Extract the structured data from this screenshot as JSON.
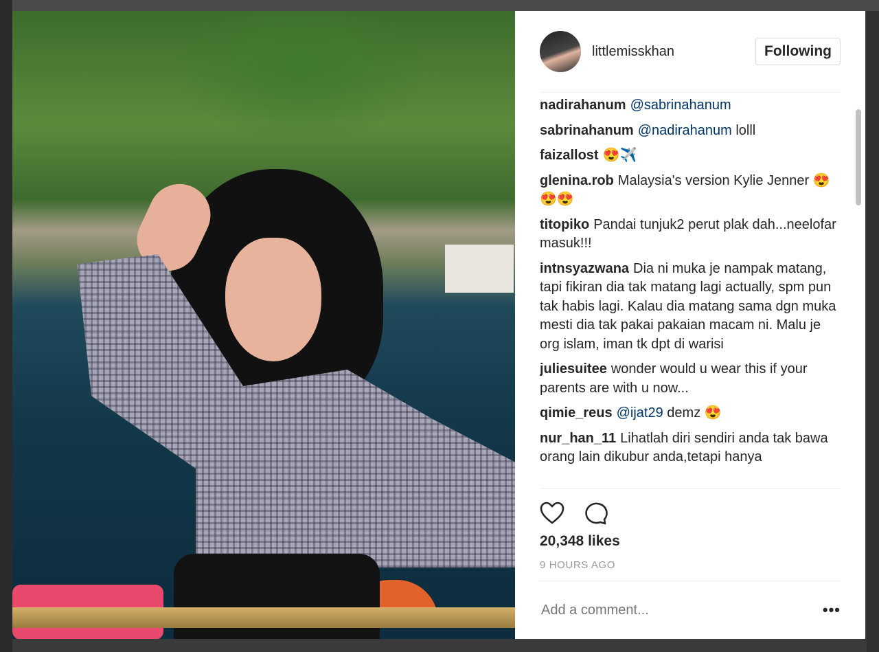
{
  "post": {
    "username": "littlemisskhan",
    "follow_label": "Following",
    "likes": "20,348 likes",
    "time": "9 HOURS AGO",
    "comment_placeholder": "Add a comment...",
    "more": "•••"
  },
  "comments": [
    {
      "user": "nadirahanum",
      "mention": "@sabrinahanum",
      "text": ""
    },
    {
      "user": "sabrinahanum",
      "mention": "@nadirahanum",
      "text": " lolll"
    },
    {
      "user": "faizallost",
      "mention": "",
      "text": "😍✈️"
    },
    {
      "user": "glenina.rob",
      "mention": "",
      "text": "Malaysia's version Kylie Jenner 😍😍😍"
    },
    {
      "user": "titopiko",
      "mention": "",
      "text": "Pandai tunjuk2 perut plak dah...neelofar masuk!!!"
    },
    {
      "user": "intnsyazwana",
      "mention": "",
      "text": "Dia ni muka je nampak matang, tapi fikiran dia tak matang lagi actually, spm pun tak habis lagi. Kalau dia matang sama dgn muka mesti dia tak pakai pakaian macam ni. Malu je org islam, iman tk dpt di warisi"
    },
    {
      "user": "juliesuitee",
      "mention": "",
      "text": "wonder would u wear this if your parents are with u now..."
    },
    {
      "user": "qimie_reus",
      "mention": "@ijat29",
      "text": " demz 😍"
    },
    {
      "user": "nur_han_11",
      "mention": "",
      "text": "Lihatlah diri sendiri anda tak bawa orang lain dikubur anda,tetapi hanya"
    }
  ]
}
